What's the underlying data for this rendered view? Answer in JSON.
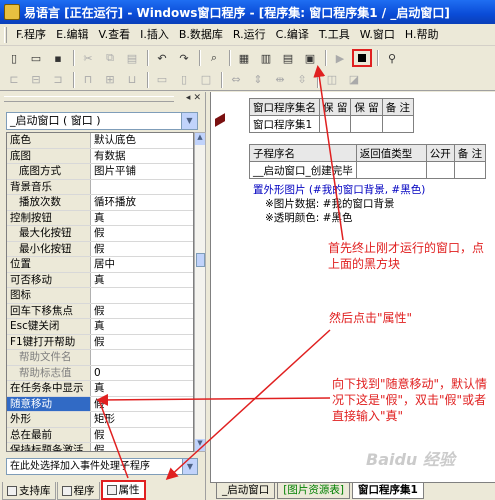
{
  "window": {
    "title": "易语言 [正在运行] - Windows窗口程序 - [程序集: 窗口程序集1 / _启动窗口]"
  },
  "menu": {
    "items": [
      "F.程序",
      "E.编辑",
      "V.查看",
      "I.插入",
      "B.数据库",
      "R.运行",
      "C.编译",
      "T.工具",
      "W.窗口",
      "H.帮助"
    ]
  },
  "toolbar1": {
    "buttons": [
      "new-file-icon",
      "open-file-icon",
      "save-file-icon",
      "cut-icon",
      "copy-icon",
      "paste-icon",
      "undo-icon",
      "redo-icon",
      "find-icon",
      "layout-icon-1",
      "layout-icon-2",
      "layout-icon-3",
      "layout-icon-4",
      "run-icon",
      "stop-icon",
      "debug-icon"
    ]
  },
  "left_panel": {
    "window_selector": "_启动窗口 ( 窗口 )",
    "properties": [
      {
        "name": "底色",
        "value": "默认底色",
        "indent": false
      },
      {
        "name": "底图",
        "value": "有数据",
        "indent": false
      },
      {
        "name": "底图方式",
        "value": "图片平铺",
        "indent": true
      },
      {
        "name": "背景音乐",
        "value": "",
        "indent": false
      },
      {
        "name": "播放次数",
        "value": "循环播放",
        "indent": true
      },
      {
        "name": "控制按钮",
        "value": "真",
        "indent": false
      },
      {
        "name": "最大化按钮",
        "value": "假",
        "indent": true
      },
      {
        "name": "最小化按钮",
        "value": "假",
        "indent": true
      },
      {
        "name": "位置",
        "value": "居中",
        "indent": false
      },
      {
        "name": "可否移动",
        "value": "真",
        "indent": false
      },
      {
        "name": "图标",
        "value": "",
        "indent": false
      },
      {
        "name": "回车下移焦点",
        "value": "假",
        "indent": false
      },
      {
        "name": "Esc键关闭",
        "value": "真",
        "indent": false
      },
      {
        "name": "F1键打开帮助",
        "value": "假",
        "indent": false
      },
      {
        "name": "帮助文件名",
        "value": "",
        "indent": true,
        "disabled": true
      },
      {
        "name": "帮助标志值",
        "value": "0",
        "indent": true,
        "disabled": true
      },
      {
        "name": "在任务条中显示",
        "value": "真",
        "indent": false
      },
      {
        "name": "随意移动",
        "value": "假",
        "indent": false,
        "selected": true
      },
      {
        "name": "外形",
        "value": "矩形",
        "indent": false
      },
      {
        "name": "总在最前",
        "value": "假",
        "indent": false
      },
      {
        "name": "保持标题条激活",
        "value": "假",
        "indent": false
      }
    ],
    "event_selector": "在此处选择加入事件处理子程序",
    "tabs": [
      "支持库",
      "程序",
      "属性"
    ]
  },
  "editor": {
    "table1": {
      "headers": [
        "窗口程序集名",
        "保 留",
        "保 留",
        "备 注"
      ],
      "row": [
        "窗口程序集1",
        "",
        "",
        ""
      ]
    },
    "table2": {
      "headers": [
        "子程序名",
        "返回值类型",
        "公开",
        "备 注"
      ],
      "row": [
        "__启动窗口_创建完毕",
        "",
        "",
        ""
      ]
    },
    "code": [
      "置外形图片 (#我的窗口背景, #黑色)",
      "※图片数据: #我的窗口背景",
      "※透明颜色: #黑色"
    ]
  },
  "annotations": {
    "first": "首先终止刚才运行的窗口，点上面的黑方块",
    "second": "然后点击\"属性\"",
    "third": "向下找到\"随意移动\"，默认情况下这是\"假\"，双击\"假\"或者直接输入\"真\""
  },
  "editor_tabs": [
    "_启动窗口",
    "[图片资源表]",
    "窗口程序集1"
  ],
  "watermark": "Baidu 经验",
  "colors": {
    "annotation": "#e02020",
    "selection": "#316ac5",
    "titlebar": "#0a4bd6"
  }
}
